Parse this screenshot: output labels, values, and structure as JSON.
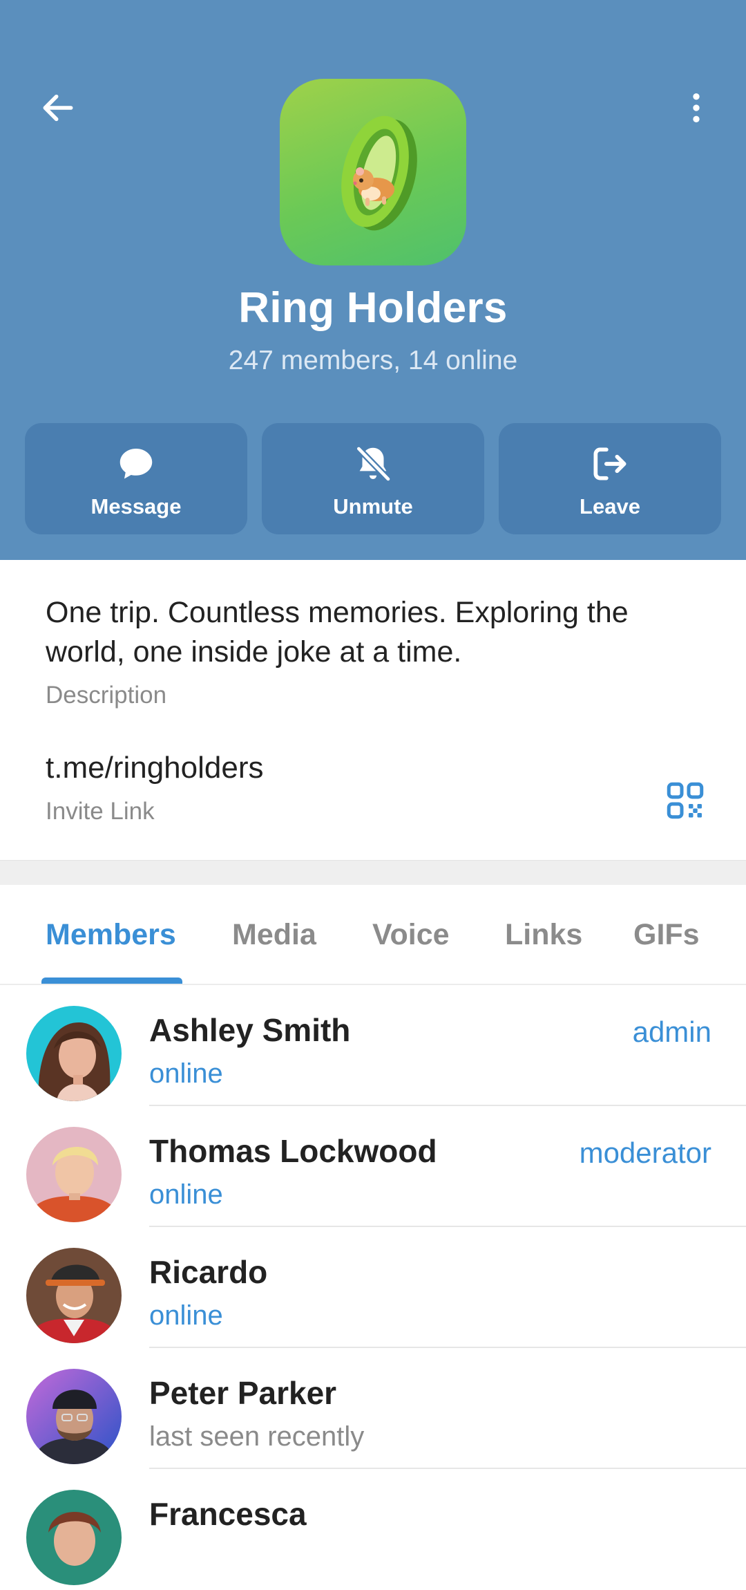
{
  "header": {
    "title": "Ring Holders",
    "subtitle": "247 members, 14 online",
    "actions": [
      {
        "label": "Message",
        "icon": "message-icon"
      },
      {
        "label": "Unmute",
        "icon": "bell-off-icon"
      },
      {
        "label": "Leave",
        "icon": "leave-icon"
      }
    ],
    "colors": {
      "background": "#5b8fbd",
      "button": "#4a7eb0"
    }
  },
  "info": {
    "description": "One trip. Countless memories. Exploring the world, one inside joke at a time.",
    "description_label": "Description",
    "invite_link": "t.me/ringholders",
    "invite_label": "Invite Link"
  },
  "tabs": [
    "Members",
    "Media",
    "Voice",
    "Links",
    "GIFs"
  ],
  "active_tab": "Members",
  "members": [
    {
      "name": "Ashley Smith",
      "status": "online",
      "role": "admin"
    },
    {
      "name": "Thomas Lockwood",
      "status": "online",
      "role": "moderator"
    },
    {
      "name": "Ricardo",
      "status": "online",
      "role": ""
    },
    {
      "name": "Peter Parker",
      "status": "last seen recently",
      "role": ""
    },
    {
      "name": "Francesca",
      "status": "",
      "role": ""
    }
  ],
  "accent_color": "#3a8fd6"
}
